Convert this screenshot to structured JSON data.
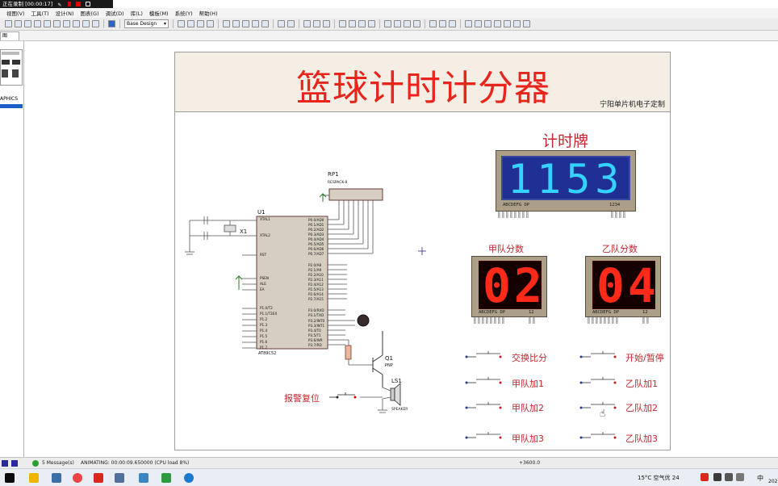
{
  "recording": {
    "label": "正在录制 [00:00:17]"
  },
  "menu": {
    "items": [
      "视图(V)",
      "工具(T)",
      "设计(N)",
      "图表(G)",
      "调试(D)",
      "库(L)",
      "模板(M)",
      "系统(Y)",
      "帮助(H)"
    ]
  },
  "toolbar": {
    "design_select": "Base Design"
  },
  "tab": {
    "label": "图"
  },
  "leftpanel": {
    "graphics_label": "APHICS"
  },
  "sheet": {
    "title": "篮球计时计分器",
    "subtitle": "宁阳单片机电子定制"
  },
  "timer": {
    "label": "计时牌",
    "digits": "1153",
    "pin_label_left": "ABCDEFG DP",
    "pin_label_right": "1234"
  },
  "scoreA": {
    "label": "甲队分数",
    "digits": "02",
    "pin_label_left": "ABCDEFG DP",
    "pin_label_right": "12"
  },
  "scoreB": {
    "label": "乙队分数",
    "digits": "04",
    "pin_label_left": "ABCDEFG DP",
    "pin_label_right": "12"
  },
  "buttons": {
    "swap": "交换比分",
    "start_pause": "开始/暂停",
    "a_plus1": "甲队加1",
    "b_plus1": "乙队加1",
    "a_plus2": "甲队加2",
    "b_plus2": "乙队加2",
    "a_plus3": "甲队加3",
    "b_plus3": "乙队加3",
    "alarm_reset": "报警复位"
  },
  "schematic": {
    "rp1": "RP1",
    "rp1_part": "RESPACK-8",
    "u1": "U1",
    "u1_part": "AT89C52",
    "x1": "X1",
    "q1": "Q1",
    "q1_type": "PNP",
    "ls1": "LS1",
    "ls1_type": "SPEAKER",
    "pins_left": [
      "XTAL1",
      "XTAL2",
      "RST",
      "PSEN",
      "ALE",
      "EA",
      "P1.0/T2",
      "P1.1/T2EX",
      "P1.2",
      "P1.3",
      "P1.4",
      "P1.5",
      "P1.6",
      "P1.7"
    ],
    "pins_right": [
      "P0.0/AD0",
      "P0.1/AD1",
      "P0.2/AD2",
      "P0.3/AD3",
      "P0.4/AD4",
      "P0.5/AD5",
      "P0.6/AD6",
      "P0.7/AD7",
      "P2.0/A8",
      "P2.1/A9",
      "P2.2/A10",
      "P2.3/A11",
      "P2.4/A12",
      "P2.5/A13",
      "P2.6/A14",
      "P2.7/A15",
      "P3.0/RXD",
      "P3.1/TXD",
      "P3.2/INT0",
      "P3.3/INT1",
      "P3.4/T0",
      "P3.5/T1",
      "P3.6/WR",
      "P3.7/RD"
    ]
  },
  "status": {
    "messages": "5 Message(s)",
    "animating": "ANIMATING: 00:00:09.650000 (CPU load 8%)",
    "coords": "+3600.0"
  },
  "taskbar": {
    "weather": "15°C 空气优 24",
    "ime": "中",
    "year": "202"
  }
}
